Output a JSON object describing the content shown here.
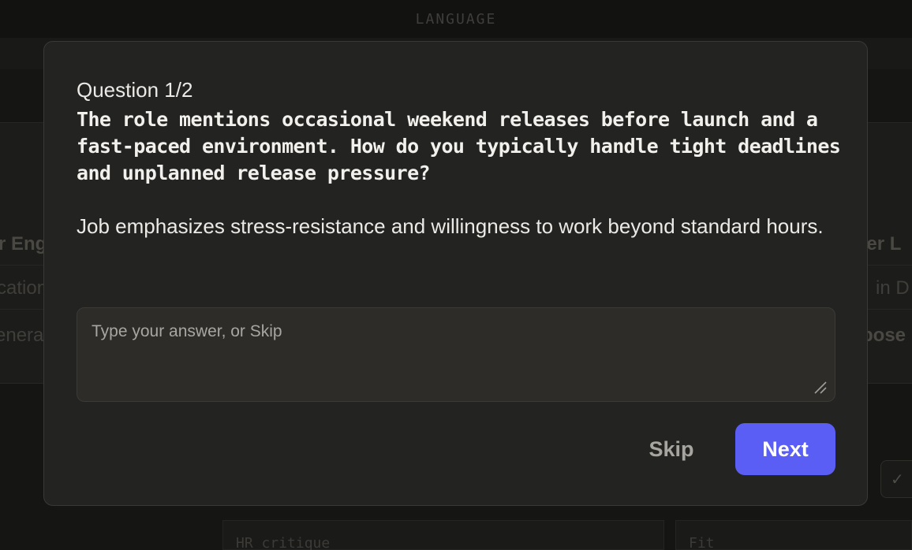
{
  "background": {
    "top_label": "LANGUAGE",
    "left_card": {
      "title_fragment": "r Eng",
      "line2_fragment": "cation",
      "line3_fragment": "enera"
    },
    "right_card": {
      "title_fragment": "ver L",
      "line2_fragment": "in D",
      "line3_fragment": "bose"
    },
    "bottom_left_label": "HR critique",
    "bottom_right_label": "Fit"
  },
  "modal": {
    "counter": "Question 1/2",
    "question": "The role mentions occasional weekend releases before launch and a fast-paced environment. How do you typically handle tight deadlines and unplanned release pressure?",
    "hint": "Job emphasizes stress-resistance and willingness to work beyond standard hours.",
    "answer": {
      "value": "",
      "placeholder": "Type your answer, or Skip"
    },
    "skip_label": "Skip",
    "next_label": "Next"
  },
  "colors": {
    "accent": "#5b5ef5",
    "modal_bg": "#232322",
    "page_bg": "#151514"
  }
}
